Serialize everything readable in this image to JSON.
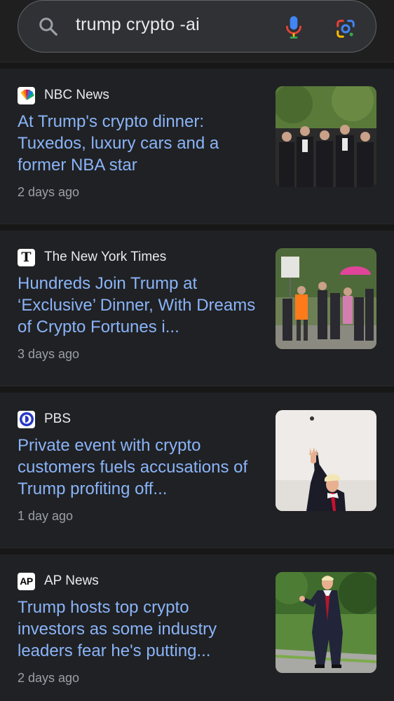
{
  "search": {
    "query": "trump crypto -ai",
    "icons": {
      "search": "search-icon",
      "voice": "microphone-icon",
      "lens": "google-lens-icon"
    }
  },
  "results": [
    {
      "source": "NBC News",
      "favicon": "nbc-peacock-icon",
      "headline": "At Trump's crypto dinner: Tuxedos, luxury cars and a former NBA star",
      "time": "2 days ago",
      "thumbnail": "group-of-men-in-tuxedos-photo"
    },
    {
      "source": "The New York Times",
      "favicon": "nyt-t-icon",
      "headline": "Hundreds Join Trump at ‘Exclusive’ Dinner, With Dreams of Crypto Fortunes i...",
      "time": "3 days ago",
      "thumbnail": "protesters-with-signs-photo"
    },
    {
      "source": "PBS",
      "favicon": "pbs-logo-icon",
      "headline": "Private event with crypto customers fuels accusations of Trump profiting off...",
      "time": "1 day ago",
      "thumbnail": "trump-waving-photo"
    },
    {
      "source": "AP News",
      "favicon": "ap-logo-icon",
      "favicon_text": "AP",
      "headline": "Trump hosts top crypto investors as some industry leaders fear he's putting...",
      "time": "2 days ago",
      "thumbnail": "trump-walking-on-lawn-photo"
    }
  ],
  "colors": {
    "background": "#1f1f1f",
    "card": "#202124",
    "headline": "#8ab4f8",
    "secondary_text": "#9aa0a6"
  }
}
